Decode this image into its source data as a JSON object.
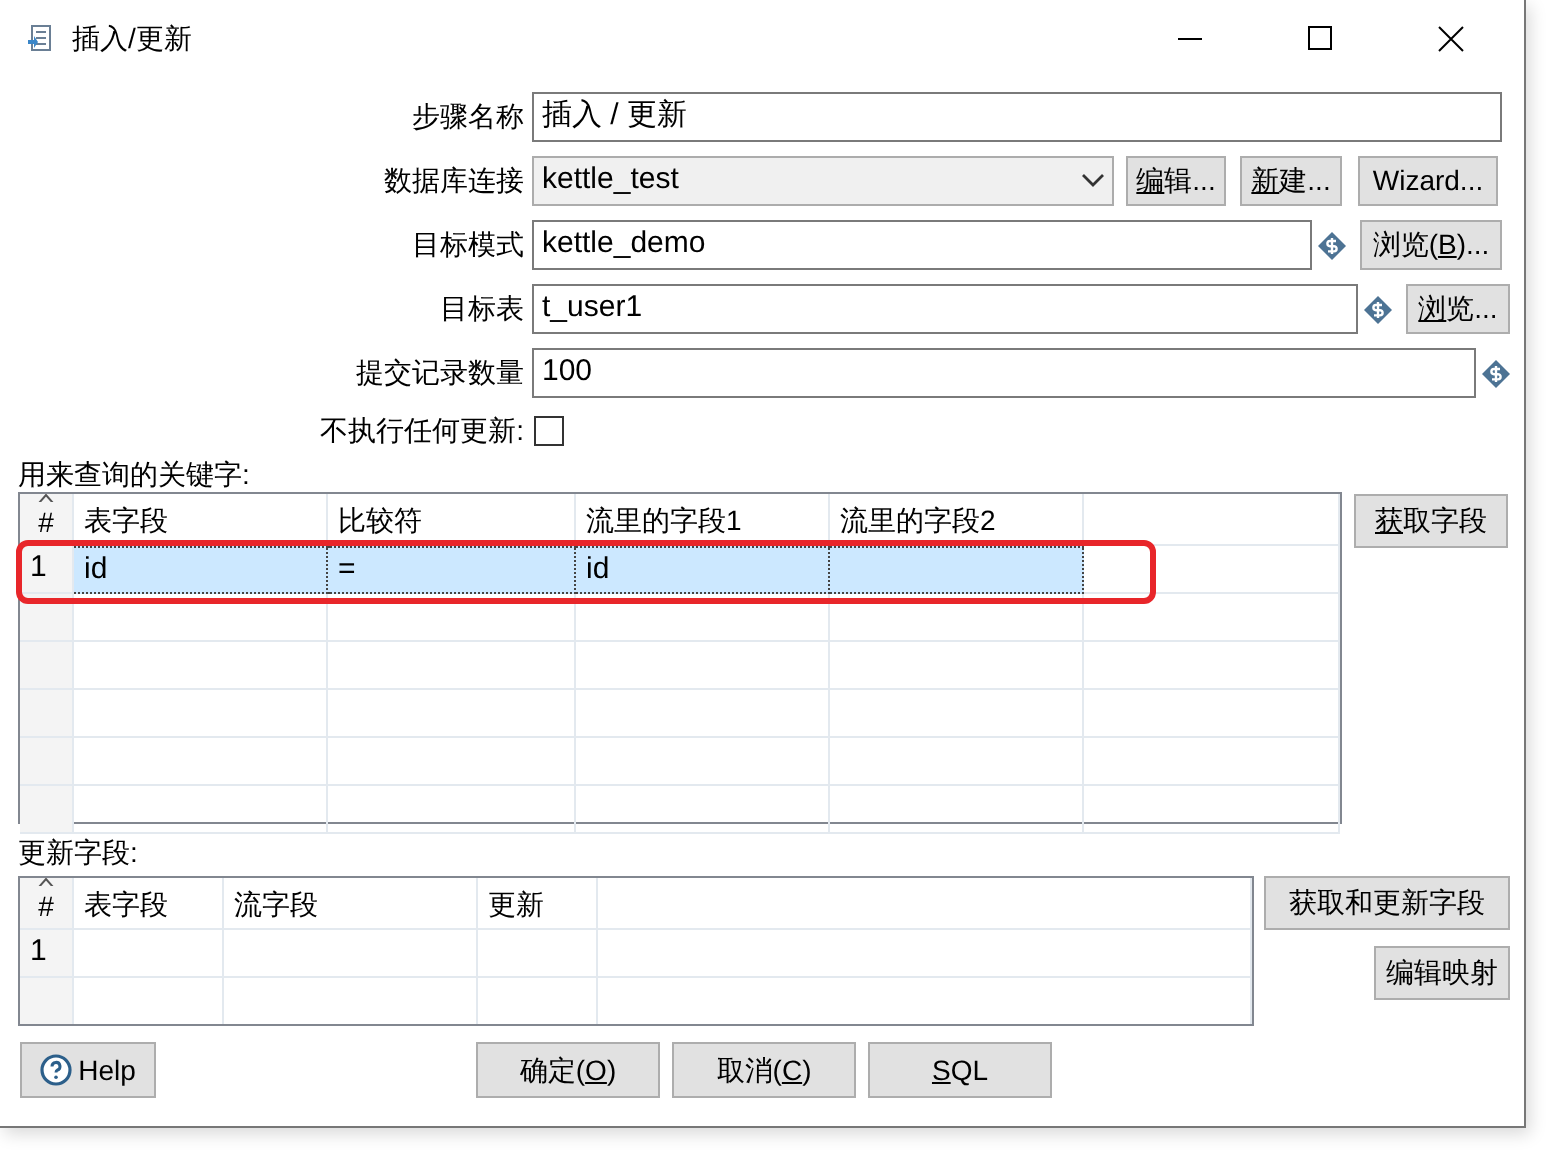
{
  "window": {
    "title": "插入/更新"
  },
  "fields": [
    {
      "kind": "text",
      "label": "步骤名称",
      "value": "插入 / 更新"
    },
    {
      "kind": "select",
      "label": "数据库连接",
      "value": "kettle_test",
      "buttons": [
        {
          "key": "编",
          "after": "辑..."
        },
        {
          "key": "新",
          "after": "建..."
        },
        {
          "before": "Wizard..."
        }
      ]
    },
    {
      "kind": "text",
      "label": "目标模式",
      "value": "kettle_demo",
      "variable": true,
      "buttons": [
        {
          "before": "浏览(",
          "key": "B",
          "after": ")..."
        }
      ]
    },
    {
      "kind": "text",
      "label": "目标表",
      "value": "t_user1",
      "variable": true,
      "buttons": [
        {
          "key": "浏",
          "after": "览..."
        }
      ]
    },
    {
      "kind": "text",
      "label": "提交记录数量",
      "value": "100",
      "variable": true
    },
    {
      "kind": "checkbox",
      "label": "不执行任何更新:",
      "checked": false
    }
  ],
  "key_section": {
    "label": "用来查询的关键字:",
    "columns": [
      "#",
      "表字段",
      "比较符",
      "流里的字段1",
      "流里的字段2"
    ],
    "rows": [
      {
        "cells": [
          "1",
          "id",
          "=",
          "id"
        ],
        "selected": true,
        "highlighted": true
      }
    ],
    "button": {
      "key": "获",
      "after": "取字段"
    }
  },
  "update_section": {
    "label": "更新字段:",
    "columns": [
      "#",
      "表字段",
      "流字段",
      "更新"
    ],
    "rows": [
      {
        "cells": [
          "1"
        ],
        "selected": false
      }
    ],
    "buttons": [
      {
        "before": "获取和更新字段"
      },
      {
        "before": "编辑映射"
      }
    ]
  },
  "footer": {
    "help": "Help",
    "buttons": [
      {
        "before": "确定(",
        "key": "O",
        "after": ")"
      },
      {
        "before": "取消(",
        "key": "C",
        "after": ")"
      },
      {
        "key": "S",
        "after": "QL"
      }
    ]
  }
}
